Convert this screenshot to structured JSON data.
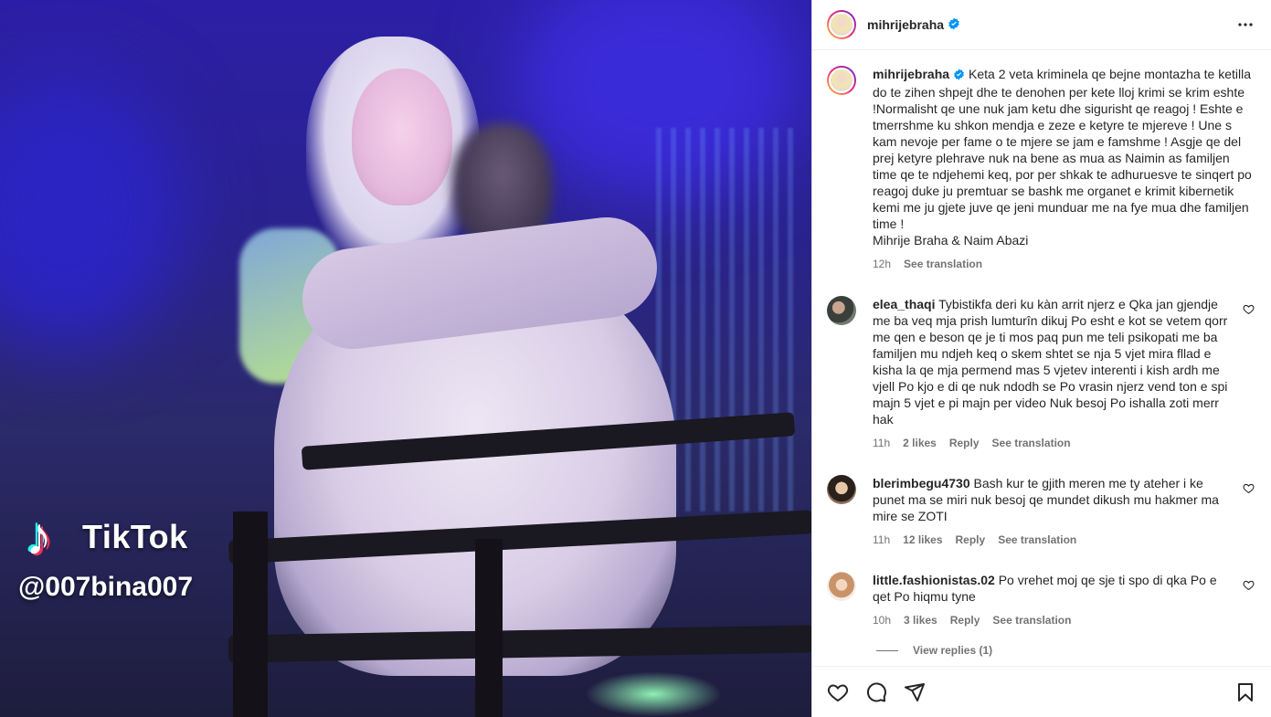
{
  "video": {
    "watermark_brand": "TikTok",
    "watermark_handle": "@007bina007"
  },
  "post": {
    "author": "mihrijebraha",
    "verified": true,
    "caption": "Keta 2 veta kriminela qe bejne montazha te ketilla do te zihen shpejt dhe te denohen per kete lloj krimi se krim eshte !Normalisht qe une nuk jam ketu dhe sigurisht qe reagoj ! Eshte e tmerrshme ku shkon mendja e zeze e ketyre te mjereve ! Une s kam nevoje per fame o te mjere se jam e famshme ! Asgje qe del prej ketyre plehrave nuk na bene as mua as Naimin as familjen time qe te ndjehemi keq, por per shkak te adhuruesve te sinqert po reagoj duke ju premtuar se bashk me organet e krimit kibernetik kemi me ju gjete juve qe jeni munduar me na fye mua dhe familjen time !",
    "signature": "Mihrije Braha & Naim Abazi",
    "time": "12h",
    "see_translation": "See translation"
  },
  "comments": [
    {
      "username": "elea_thaqi",
      "text": "Tybistikfa deri ku kàn arrit njerz e Qka jan gjendje me ba veq mja prish lumturîn dikuj Po esht e kot se vetem qorr me qen e beson qe je ti mos paq pun me teli psikopati me ba familjen mu ndjeh keq o skem shtet se nja 5 vjet mira fllad e kisha la qe mja permend mas 5 vjetev interenti i kish ardh me vjell Po kjo e di qe nuk ndodh se Po vrasin njerz vend ton e spi majn 5 vjet e pi majn per video Nuk besoj Po ishalla zoti merr hak",
      "time": "11h",
      "likes": "2 likes",
      "reply": "Reply",
      "see_translation": "See translation"
    },
    {
      "username": "blerimbegu4730",
      "text": "Bash kur te gjith meren me ty ateher i ke punet ma se miri nuk besoj qe mundet dikush mu hakmer ma mire se ZOTI",
      "time": "11h",
      "likes": "12 likes",
      "reply": "Reply",
      "see_translation": "See translation"
    },
    {
      "username": "little.fashionistas.02",
      "text": "Po vrehet moj qe sje ti spo di qka Po e qet Po hiqmu tyne",
      "time": "10h",
      "likes": "3 likes",
      "reply": "Reply",
      "see_translation": "See translation",
      "view_replies": "View replies (1)"
    }
  ],
  "icons": {
    "verified": "verified-badge-icon",
    "more": "more-options-icon",
    "heart": "heart-icon",
    "comment": "comment-icon",
    "share": "share-icon",
    "save": "bookmark-icon"
  },
  "colors": {
    "verified_blue": "#0095f6",
    "text": "#262626",
    "muted": "#737373"
  }
}
